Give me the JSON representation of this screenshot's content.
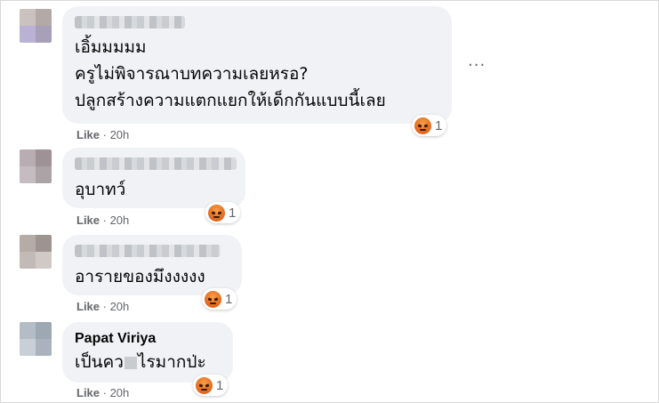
{
  "comments": [
    {
      "name_blurred": true,
      "lines": [
        "เอิ้มมมมม",
        "ครูไม่พิจารณาบทความเลยหรอ?",
        "ปลูกสร้างความแตกแยกให้เด็กกันแบบนี้เลย"
      ],
      "reaction_icon": "angry-reaction-icon",
      "reaction_count": "1",
      "like_label": "Like",
      "time": "20h"
    },
    {
      "name_blurred": true,
      "lines": [
        "อุบาทว์"
      ],
      "reaction_icon": "angry-reaction-icon",
      "reaction_count": "1",
      "like_label": "Like",
      "time": "20h"
    },
    {
      "name_blurred": true,
      "lines": [
        "อารายของมึงงงงง"
      ],
      "reaction_icon": "angry-reaction-icon",
      "reaction_count": "1",
      "like_label": "Like",
      "time": "20h"
    },
    {
      "name": "Papat Viriya",
      "lines": [
        "เป็นคว",
        "ไรมากป่ะ"
      ],
      "reaction_icon": "angry-reaction-icon",
      "reaction_count": "1",
      "like_label": "Like",
      "time": "20h"
    }
  ],
  "more_options": "...",
  "separator": " · ",
  "colors": {
    "bubble": "#f0f2f5",
    "meta_text": "#65676b",
    "angry": "#e8701f"
  }
}
